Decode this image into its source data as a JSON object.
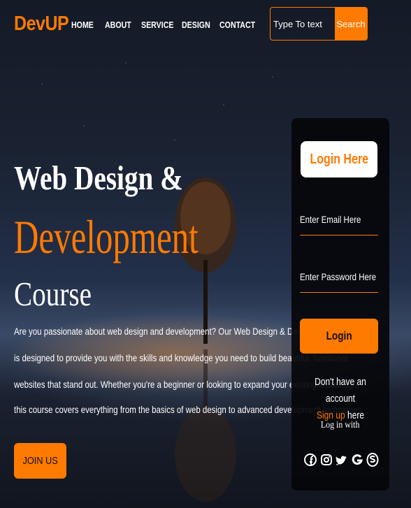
{
  "brand": {
    "name": "DevUP",
    "accent": "#ff7a00"
  },
  "nav": {
    "items": [
      "HOME",
      "ABOUT",
      "SERVICE",
      "DESIGN",
      "CONTACT"
    ]
  },
  "search": {
    "placeholder": "Type To text",
    "button_label": "Search"
  },
  "hero": {
    "line1": "Web Design &",
    "line2": "Development",
    "line3": "Course",
    "description": [
      "Are you passionate about web design and development? Our Web Design & Development Course",
      "is designed to provide you with the skills and knowledge you need to build beautiful, functional",
      "websites that stand out. Whether you're a beginner or looking to expand your existing knowledge,",
      "this course covers everything from the basics of web design to advanced development techniques."
    ],
    "join_label": "JOIN US"
  },
  "login": {
    "title": "Login Here",
    "email_placeholder": "Enter Email Here",
    "password_placeholder": "Enter Password Here",
    "button_label": "Login",
    "no_account": "Don't have an account",
    "signup": "Sign up",
    "signup_suffix": "here",
    "login_with": "Log in with",
    "socials": [
      "facebook-icon",
      "instagram-icon",
      "twitter-icon",
      "google-icon",
      "skype-icon"
    ]
  }
}
